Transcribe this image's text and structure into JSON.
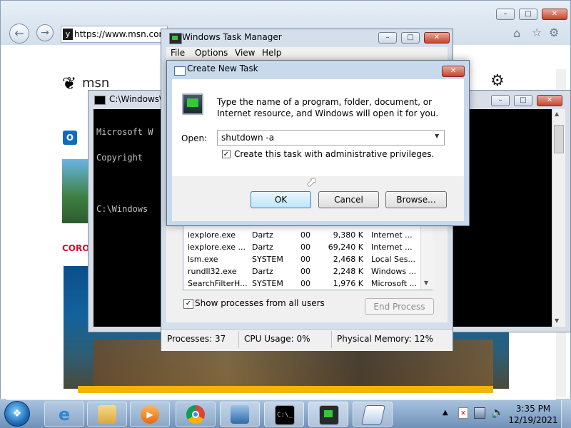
{
  "browser": {
    "url": "https://www.msn.com",
    "logo_text": "msn",
    "corona_text": "CORO"
  },
  "cmd": {
    "title": "C:\\Windows\\",
    "lines": [
      "Microsoft W",
      "Copyright ",
      "",
      "C:\\Windows"
    ]
  },
  "task_manager": {
    "title": "Windows Task Manager",
    "menu": [
      "File",
      "Options",
      "View",
      "Help"
    ],
    "processes": [
      {
        "name": "iexplore.exe",
        "user": "Dartz",
        "cpu": "00",
        "mem": "9,380 K",
        "desc": "Internet ..."
      },
      {
        "name": "iexplore.exe ...",
        "user": "Dartz",
        "cpu": "00",
        "mem": "69,240 K",
        "desc": "Internet ..."
      },
      {
        "name": "lsm.exe",
        "user": "SYSTEM",
        "cpu": "00",
        "mem": "2,468 K",
        "desc": "Local Ses..."
      },
      {
        "name": "rundll32.exe",
        "user": "Dartz",
        "cpu": "00",
        "mem": "2,248 K",
        "desc": "Windows ..."
      },
      {
        "name": "SearchFilterH...",
        "user": "SYSTEM",
        "cpu": "00",
        "mem": "1,976 K",
        "desc": "Microsoft ..."
      }
    ],
    "show_all_label": "Show processes from all users",
    "end_process_label": "End Process",
    "status": {
      "processes": "Processes: 37",
      "cpu": "CPU Usage: 0%",
      "memory": "Physical Memory: 12%"
    }
  },
  "dialog": {
    "title": "Create New Task",
    "description": "Type the name of a program, folder, document, or Internet resource, and Windows will open it for you.",
    "open_label": "Open:",
    "open_value": "shutdown -a",
    "admin_label": "Create this task with administrative privileges.",
    "ok_label": "OK",
    "cancel_label": "Cancel",
    "browse_label": "Browse..."
  },
  "taskbar": {
    "time": "3:35 PM",
    "date": "12/19/2021"
  },
  "colors": {
    "taskbar": "#7d9fc4",
    "dialog_frame": "#c8d9ec",
    "close_red": "#c7442d",
    "banner_yellow": "#f2b600"
  }
}
